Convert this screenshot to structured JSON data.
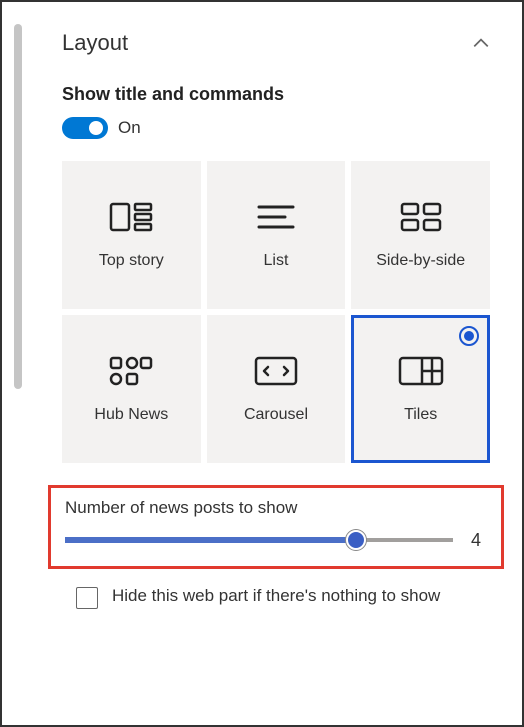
{
  "section": {
    "title": "Layout"
  },
  "toggle": {
    "label": "Show title and commands",
    "state_label": "On",
    "on": true
  },
  "layout_options": [
    {
      "id": "top-story",
      "label": "Top story",
      "selected": false
    },
    {
      "id": "list",
      "label": "List",
      "selected": false
    },
    {
      "id": "side-by-side",
      "label": "Side-by-side",
      "selected": false
    },
    {
      "id": "hub-news",
      "label": "Hub News",
      "selected": false
    },
    {
      "id": "carousel",
      "label": "Carousel",
      "selected": false
    },
    {
      "id": "tiles",
      "label": "Tiles",
      "selected": true
    }
  ],
  "slider": {
    "label": "Number of news posts to show",
    "value": "4"
  },
  "checkbox": {
    "label": "Hide this web part if there's nothing to show",
    "checked": false
  }
}
